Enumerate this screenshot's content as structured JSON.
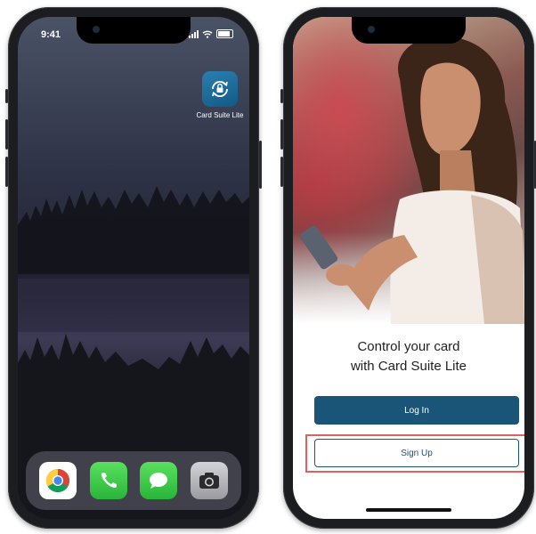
{
  "home_screen": {
    "status": {
      "time": "9:41"
    },
    "app": {
      "label": "Card Suite Lite",
      "icon": "lock-refresh-icon"
    },
    "dock": [
      {
        "name": "chrome",
        "icon": "chrome-icon"
      },
      {
        "name": "phone",
        "icon": "phone-icon"
      },
      {
        "name": "messages",
        "icon": "messages-icon"
      },
      {
        "name": "camera",
        "icon": "camera-icon"
      }
    ]
  },
  "app_screen": {
    "headline_line1": "Control your card",
    "headline_line2": "with Card Suite Lite",
    "login_label": "Log In",
    "signup_label": "Sign Up",
    "colors": {
      "primary": "#1a5476",
      "highlight": "#e0605e"
    }
  }
}
